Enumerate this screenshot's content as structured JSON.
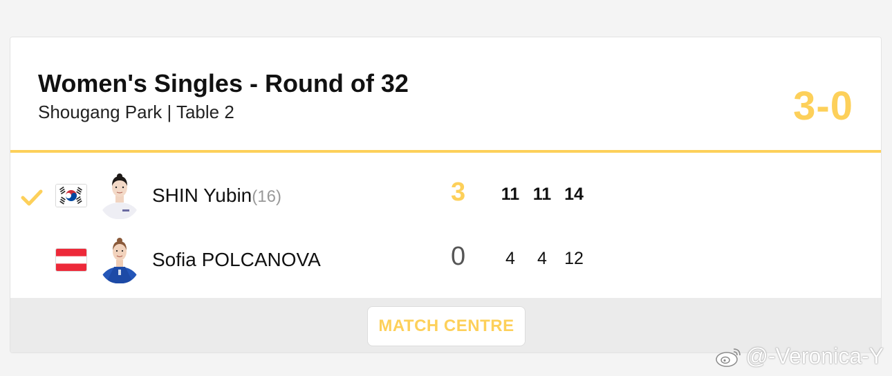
{
  "match": {
    "title": "Women's Singles - Round of 32",
    "venue": "Shougang Park | Table 2",
    "score": "3-0"
  },
  "players": [
    {
      "name": "SHIN Yubin",
      "seed": "(16)",
      "flag": "korea-flag",
      "sets_won": "3",
      "games": [
        "11",
        "11",
        "14"
      ],
      "winner": true
    },
    {
      "name": "Sofia POLCANOVA",
      "seed": "",
      "flag": "austria-flag",
      "sets_won": "0",
      "games": [
        "4",
        "4",
        "12"
      ],
      "winner": false
    }
  ],
  "footer": {
    "match_centre_label": "MATCH CENTRE"
  },
  "watermark": {
    "text": "@-Veronica-Y"
  },
  "colors": {
    "accent": "#fdd05a",
    "korea_red": "#cd2e3a",
    "korea_blue": "#0047a0",
    "austria_red": "#ed2939"
  }
}
